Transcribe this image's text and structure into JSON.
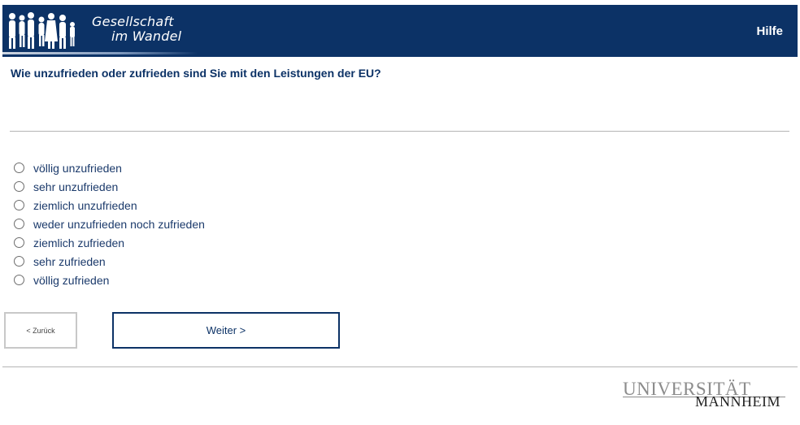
{
  "header": {
    "logo_line1": "Gesellschaft",
    "logo_line2": "im Wandel",
    "help_label": "Hilfe",
    "background_color": "#0c3266"
  },
  "question": {
    "text": "Wie unzufrieden oder zufrieden sind Sie mit den Leistungen der EU?"
  },
  "options": [
    "völlig unzufrieden",
    "sehr unzufrieden",
    "ziemlich unzufrieden",
    "weder unzufrieden noch zufrieden",
    "ziemlich zufrieden",
    "sehr zufrieden",
    "völlig zufrieden"
  ],
  "navigation": {
    "back_label": "< Zurück",
    "next_label": "Weiter >"
  },
  "footer": {
    "university_line1": "UNIVERSITÄT",
    "university_line2": "MANNHEIM"
  }
}
